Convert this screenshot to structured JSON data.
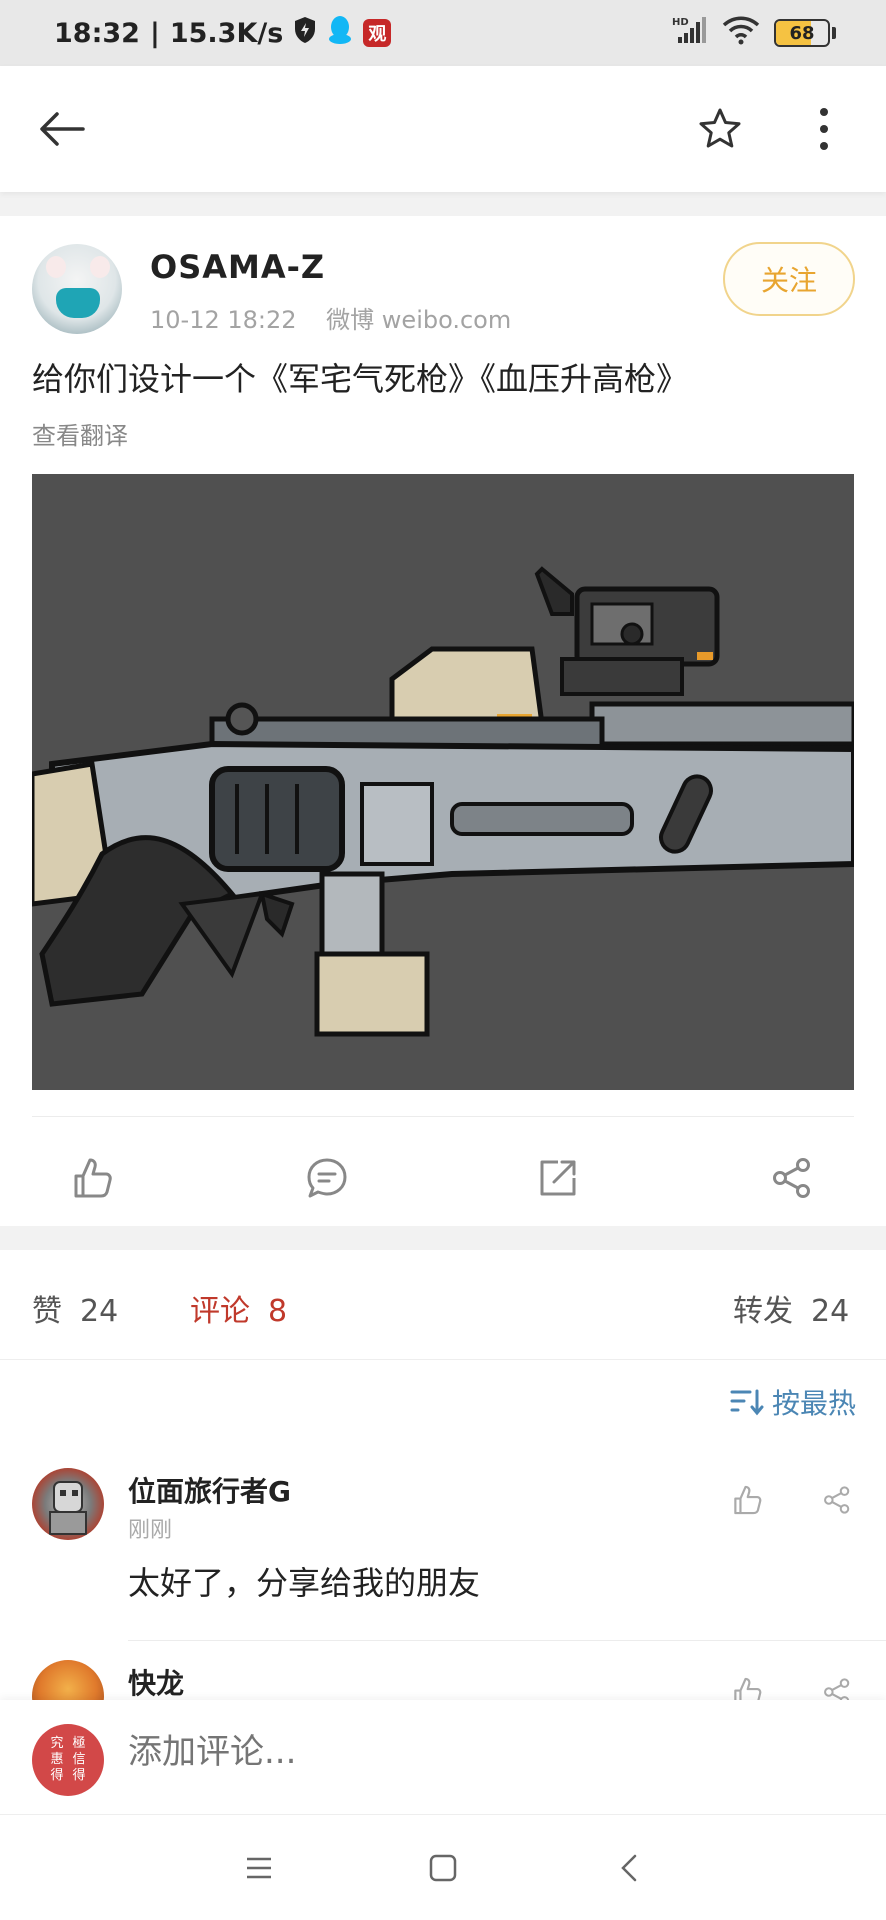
{
  "status_bar": {
    "time": "18:32",
    "separator": "|",
    "speed": "15.3K/s",
    "app_badge": "观",
    "network": "HD",
    "battery": "68",
    "battery_percent": 68
  },
  "post": {
    "username": "OSAMA-Z",
    "date": "10-12 18:22",
    "source": "微博 weibo.com",
    "follow_label": "关注",
    "text": "给你们设计一个《军宅气死枪》《血压升高枪》",
    "translate_label": "查看翻译"
  },
  "stats": {
    "likes_label": "赞",
    "likes_count": "24",
    "comments_label": "评论",
    "comments_count": "8",
    "reposts_label": "转发",
    "reposts_count": "24"
  },
  "comments_section": {
    "sort_label": "按最热",
    "items": [
      {
        "name": "位面旅行者G",
        "time": "刚刚",
        "text": "太好了，分享给我的朋友"
      },
      {
        "name": "快龙",
        "time": "",
        "text": ""
      }
    ]
  },
  "comment_input": {
    "placeholder": "添加评论...",
    "seal_chars": [
      "究",
      "極",
      "惠",
      "信",
      "得",
      "得"
    ]
  },
  "colors": {
    "accent_red": "#c0392b",
    "follow_gold": "#e8a530",
    "link_blue": "#4b86b4"
  }
}
